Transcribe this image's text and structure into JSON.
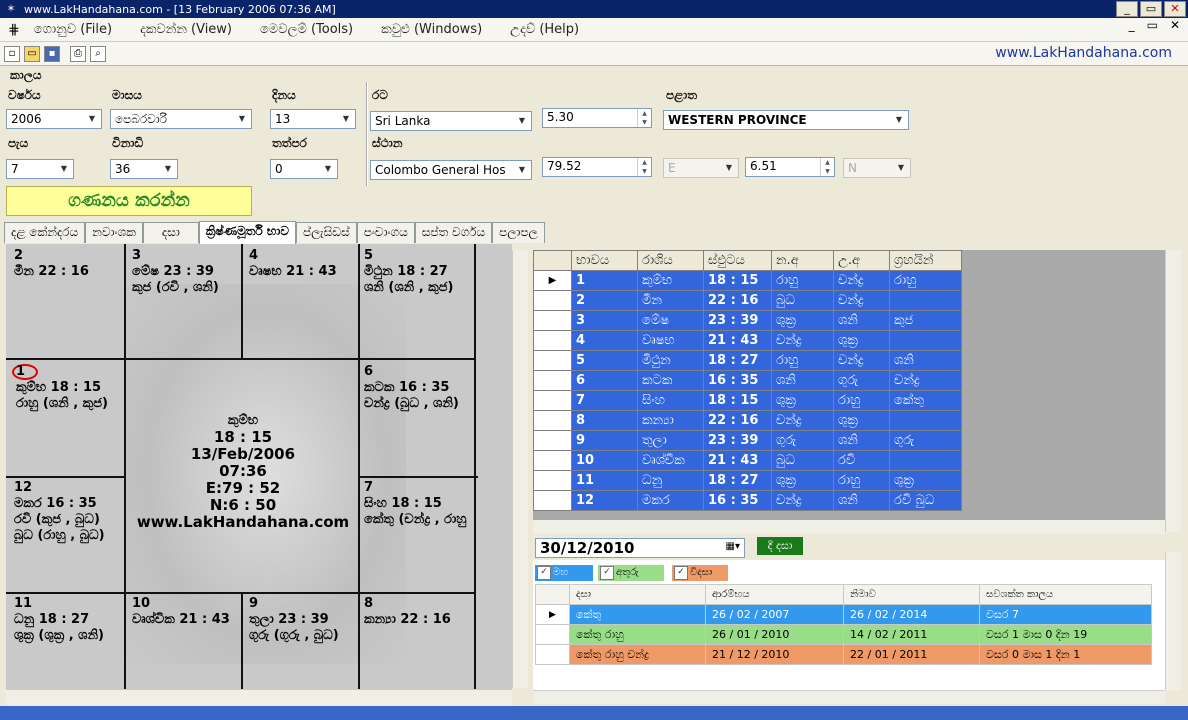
{
  "window": {
    "title": "www.LakHandahana.com - [13 February 2006 07:36 AM]",
    "buttons": [
      "_",
      "▭",
      "✕"
    ]
  },
  "menu": {
    "items": [
      "ගොනුව (File)",
      "දකවන්න (View)",
      "මෙවලම් (Tools)",
      "කවුළු (Windows)",
      "උදව් (Help)"
    ],
    "mdi_buttons": [
      "_",
      "▭",
      "✕"
    ]
  },
  "toolbar": {
    "icons": [
      "new-icon",
      "open-icon",
      "save-icon",
      "print-icon",
      "preview-icon"
    ],
    "website": "www.LakHandahana.com"
  },
  "form": {
    "section_title": "කාලය",
    "year_label": "වර්ෂය",
    "year": "2006",
    "month_label": "මාසය",
    "month": "පෙබරවාරි",
    "day_label": "දිනය",
    "day": "13",
    "hour_label": "පැය",
    "hour": "7",
    "minute_label": "විනාඩි",
    "minute": "36",
    "second_label": "තත්පර",
    "second": "0",
    "country_label": "රට",
    "country": "Sri Lanka",
    "tz": "5.30",
    "province_label": "පළාත",
    "province": "WESTERN PROVINCE",
    "place_label": "ස්ථාන",
    "place": "Colombo General Hos",
    "longitude": "79.52",
    "ew": "E",
    "latitude": "6.51",
    "ns": "N",
    "calculate": "ගණනය කරන්න"
  },
  "tabs": [
    "දළ කේන්දරය",
    "නවාංශක",
    "දසා",
    "ක්‍රිෂ්ණමූර්ති භාව",
    "ප්ලැසිඩස්",
    "පංචාංගය",
    "සප්ත වර්ගය",
    "පලාපල"
  ],
  "chart": {
    "houses": [
      {
        "num": "2",
        "lines": [
          "මීන 22 : 16"
        ]
      },
      {
        "num": "3",
        "lines": [
          "මේෂ 23 : 39",
          "කුජ (රවි , ශනි)"
        ]
      },
      {
        "num": "4",
        "lines": [
          "වෘෂභ 21 : 43"
        ]
      },
      {
        "num": "5",
        "lines": [
          "මිථුන 18 : 27",
          "ශනි (ශනි , කුජ)"
        ]
      },
      {
        "num": "1",
        "lines": [
          "කුම්භ 18 : 15",
          "රාහු (ශනි , කුජ)"
        ]
      },
      {
        "num": "6",
        "lines": [
          "කටක 16 : 35",
          "චන්ද්‍ර (බුධ , ශනි)"
        ]
      },
      {
        "num": "12",
        "lines": [
          "මකර 16 : 35",
          "රවි (කුජ , බුධ)",
          "බුධ (රාහු , බුධ)"
        ]
      },
      {
        "num": "7",
        "lines": [
          "සිංහ 18 : 15",
          "කේතු (චන්ද්‍ර , රාහු"
        ]
      },
      {
        "num": "11",
        "lines": [
          "ධනු 18 : 27",
          "ශුක්‍ර (ශුක්‍ර , ශනි)"
        ]
      },
      {
        "num": "10",
        "lines": [
          "වෘශ්චික 21 : 43"
        ]
      },
      {
        "num": "9",
        "lines": [
          "තුලා 23 : 39",
          "ගුරු (ගුරු , බුධ)"
        ]
      },
      {
        "num": "8",
        "lines": [
          "කන්‍යා 22 : 16"
        ]
      }
    ],
    "center": [
      "කුම්භ",
      "18 : 15",
      "13/Feb/2006",
      "07:36",
      "E:79 : 52",
      "N:6 : 50",
      "www.LakHandahana.com"
    ]
  },
  "kp_table": {
    "headers": [
      "භාවය",
      "රාශිය",
      "ස්ඵුටය",
      "න.අ",
      "උ.අ",
      "ග්‍රහයින්"
    ],
    "rows": [
      [
        "1",
        "කුම්භ",
        "18 : 15",
        "රාහු",
        "චන්ද්‍ර",
        "රාහු"
      ],
      [
        "2",
        "මීන",
        "22 : 16",
        "බුධ",
        "චන්ද්‍ර",
        ""
      ],
      [
        "3",
        "මේෂ",
        "23 : 39",
        "ශුක්‍ර",
        "ශනි",
        "කුජ"
      ],
      [
        "4",
        "වෘෂභ",
        "21 : 43",
        "චන්ද්‍ර",
        "ශුක්‍ර",
        ""
      ],
      [
        "5",
        "මිථුන",
        "18 : 27",
        "රාහු",
        "චන්ද්‍ර",
        "ශනි"
      ],
      [
        "6",
        "කටක",
        "16 : 35",
        "ශනි",
        "ගුරු",
        "චන්ද්‍ර"
      ],
      [
        "7",
        "සිංහ",
        "18 : 15",
        "ශුක්‍ර",
        "රාහු",
        "කේතු"
      ],
      [
        "8",
        "කන්‍යා",
        "22 : 16",
        "චන්ද්‍ර",
        "ශුක්‍ර",
        ""
      ],
      [
        "9",
        "තුලා",
        "23 : 39",
        "ගුරු",
        "ශනි",
        "ගුරු"
      ],
      [
        "10",
        "වෘශ්චික",
        "21 : 43",
        "බුධ",
        "රවි",
        ""
      ],
      [
        "11",
        "ධනු",
        "18 : 27",
        "ශුක්‍ර",
        "රාහු",
        "ශුක්‍ර"
      ],
      [
        "12",
        "මකර",
        "16 : 35",
        "චන්ද්‍ර",
        "ශනි",
        "රවි බුධ"
      ]
    ]
  },
  "dasha": {
    "date": "30/12/2010",
    "button": "දී දසා",
    "checks": [
      "මහ",
      "අතුරු",
      "විදසා"
    ],
    "headers": [
      "දසා",
      "ආරම්භය",
      "නිමාව",
      "සවශක්ත කාලය"
    ],
    "rows": [
      [
        "කේතු",
        "26 / 02 / 2007",
        "26 / 02 / 2014",
        "වසර 7"
      ],
      [
        "කේතු රාහු",
        "26 / 01 / 2010",
        "14 / 02 / 2011",
        "වසර 1 මාස 0 දින 19"
      ],
      [
        "කේතු රාහු චන්ද්‍ර",
        "21 / 12 / 2010",
        "22 / 01 / 2011",
        "වසර 0 මාස 1 දින 1"
      ]
    ]
  }
}
